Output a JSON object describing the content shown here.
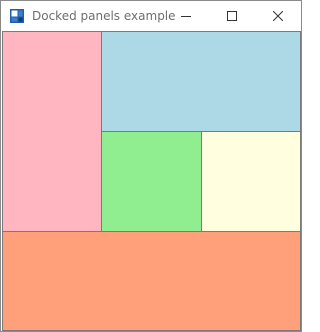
{
  "window": {
    "title": "Docked panels example",
    "app_icon": "app-window-icon",
    "controls": {
      "minimize": "minimize-icon",
      "maximize": "maximize-icon",
      "close": "close-icon"
    }
  },
  "panels": [
    {
      "name": "left-panel",
      "color": "#FFB6C1"
    },
    {
      "name": "top-panel",
      "color": "#ADD8E6"
    },
    {
      "name": "center-panel",
      "color": "#90EE90"
    },
    {
      "name": "right-panel",
      "color": "#FFFFE0"
    },
    {
      "name": "bottom-panel",
      "color": "#FFA07A"
    }
  ]
}
